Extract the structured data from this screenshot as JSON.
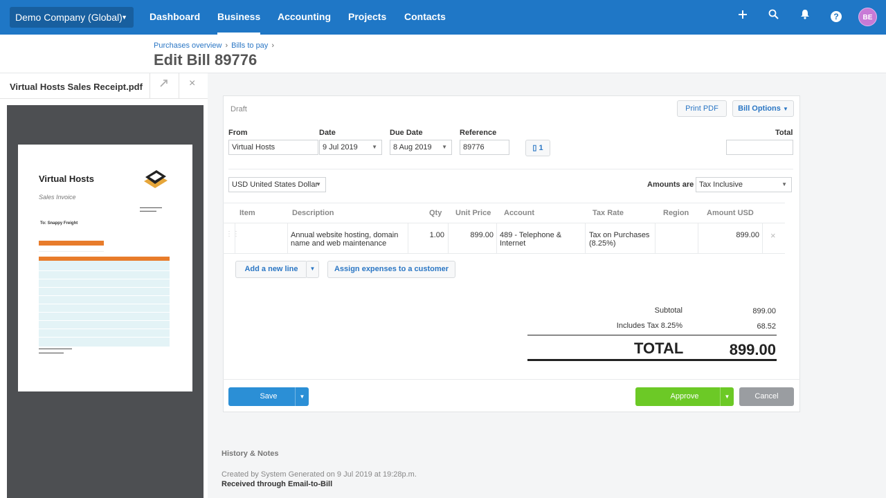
{
  "topbar": {
    "org_name": "Demo Company (Global)",
    "nav": [
      "Dashboard",
      "Business",
      "Accounting",
      "Projects",
      "Contacts"
    ],
    "active_nav": "Business",
    "avatar_initials": "BE",
    "accent_color": "#1f77c6"
  },
  "breadcrumb": [
    "Purchases overview",
    "Bills to pay"
  ],
  "page_title": "Edit Bill 89776",
  "attachment": {
    "file_name": "Virtual Hosts Sales Receipt.pdf",
    "document": {
      "company": "Virtual Hosts",
      "doc_type": "Sales Invoice",
      "to_label": "To:",
      "to_name": "Snappy Freight"
    }
  },
  "bill": {
    "status": "Draft",
    "print_pdf_label": "Print PDF",
    "options_label": "Bill Options",
    "from_label": "From",
    "from_value": "Virtual Hosts",
    "date_label": "Date",
    "date_value": "9 Jul 2019",
    "due_label": "Due Date",
    "due_value": "8 Aug 2019",
    "reference_label": "Reference",
    "reference_value": "89776",
    "attachments_count": "1",
    "total_label": "Total",
    "total_value": "",
    "currency_value": "USD United States Dollar",
    "amounts_are_label": "Amounts are",
    "amounts_are_value": "Tax Inclusive"
  },
  "table": {
    "headers": [
      "Item",
      "Description",
      "Qty",
      "Unit Price",
      "Account",
      "Tax Rate",
      "Region",
      "Amount USD"
    ],
    "rows": [
      {
        "item": "",
        "description": "Annual website hosting, domain name and web maintenance",
        "qty": "1.00",
        "unit_price": "899.00",
        "account": "489 - Telephone & Internet",
        "tax_rate": "Tax on Purchases (8.25%)",
        "region": "",
        "amount": "899.00"
      }
    ],
    "add_line_label": "Add a new line",
    "assign_label": "Assign expenses to a customer"
  },
  "summary": {
    "subtotal_label": "Subtotal",
    "subtotal_value": "899.00",
    "tax_label": "Includes Tax 8.25%",
    "tax_value": "68.52",
    "total_label": "TOTAL",
    "total_value": "899.00"
  },
  "actions": {
    "save": "Save",
    "approve": "Approve",
    "cancel": "Cancel",
    "save_color": "#2b8fd6",
    "approve_color": "#6cc926",
    "cancel_color": "#9a9da1"
  },
  "history": {
    "title": "History & Notes",
    "created": "Created by System Generated on 9 Jul 2019 at 19:28p.m.",
    "received": "Received through Email-to-Bill"
  }
}
